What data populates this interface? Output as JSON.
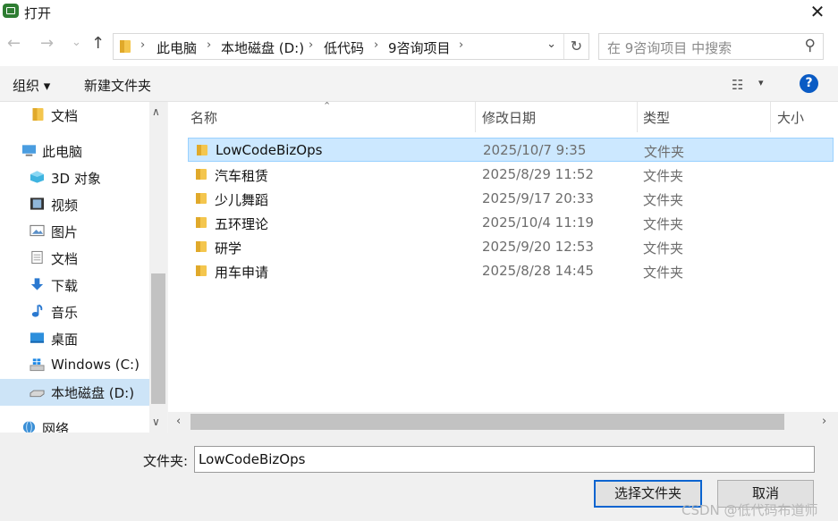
{
  "window": {
    "title": "打开",
    "close_glyph": "✕"
  },
  "nav": {
    "back_glyph": "←",
    "forward_glyph": "→",
    "recent_glyph": "⌄",
    "up_glyph": "↑",
    "breadcrumbs": [
      "此电脑",
      "本地磁盘 (D:)",
      "低代码",
      "9咨询项目"
    ],
    "crumb_sep": "›",
    "dropdown_glyph": "⌄",
    "refresh_glyph": "↻"
  },
  "search": {
    "placeholder": "在 9咨询项目 中搜索",
    "icon": "search-icon",
    "glyph": "⚲"
  },
  "toolbar": {
    "organize": "组织 ▾",
    "new_folder": "新建文件夹",
    "view_glyph": "☷",
    "view_caret": "▾",
    "help": "?"
  },
  "sidebar": {
    "items": [
      {
        "label": "文档",
        "icon": "folder-icon"
      },
      {
        "label": "此电脑",
        "icon": "computer-icon"
      },
      {
        "label": "3D 对象",
        "icon": "3d-objects-icon"
      },
      {
        "label": "视频",
        "icon": "video-icon"
      },
      {
        "label": "图片",
        "icon": "pictures-icon"
      },
      {
        "label": "文档",
        "icon": "documents-icon"
      },
      {
        "label": "下载",
        "icon": "download-icon"
      },
      {
        "label": "音乐",
        "icon": "music-icon"
      },
      {
        "label": "桌面",
        "icon": "desktop-icon"
      },
      {
        "label": "Windows (C:)",
        "icon": "windows-drive-icon"
      },
      {
        "label": "本地磁盘 (D:)",
        "icon": "drive-icon"
      },
      {
        "label": "网络",
        "icon": "network-icon"
      }
    ],
    "scroll_up": "∧",
    "scroll_down": "∨"
  },
  "files": {
    "columns": {
      "name": "名称",
      "date": "修改日期",
      "type": "类型",
      "size": "大小"
    },
    "sort_glyph": "⌃",
    "rows": [
      {
        "name": "LowCodeBizOps",
        "date": "2025/10/7 9:35",
        "type": "文件夹"
      },
      {
        "name": "汽车租赁",
        "date": "2025/8/29 11:52",
        "type": "文件夹"
      },
      {
        "name": "少儿舞蹈",
        "date": "2025/9/17 20:33",
        "type": "文件夹"
      },
      {
        "name": "五环理论",
        "date": "2025/10/4 11:19",
        "type": "文件夹"
      },
      {
        "name": "研学",
        "date": "2025/9/20 12:53",
        "type": "文件夹"
      },
      {
        "name": "用车申请",
        "date": "2025/8/28 14:45",
        "type": "文件夹"
      }
    ],
    "hscroll_left": "‹",
    "hscroll_right": "›"
  },
  "bottom": {
    "folder_label": "文件夹:",
    "folder_value": "LowCodeBizOps",
    "select_button": "选择文件夹",
    "cancel_button": "取消",
    "watermark": "CSDN @低代码布道师"
  },
  "colors": {
    "accent": "#0a64d0",
    "selection": "#cce8ff",
    "folder": "#f4c64e"
  }
}
